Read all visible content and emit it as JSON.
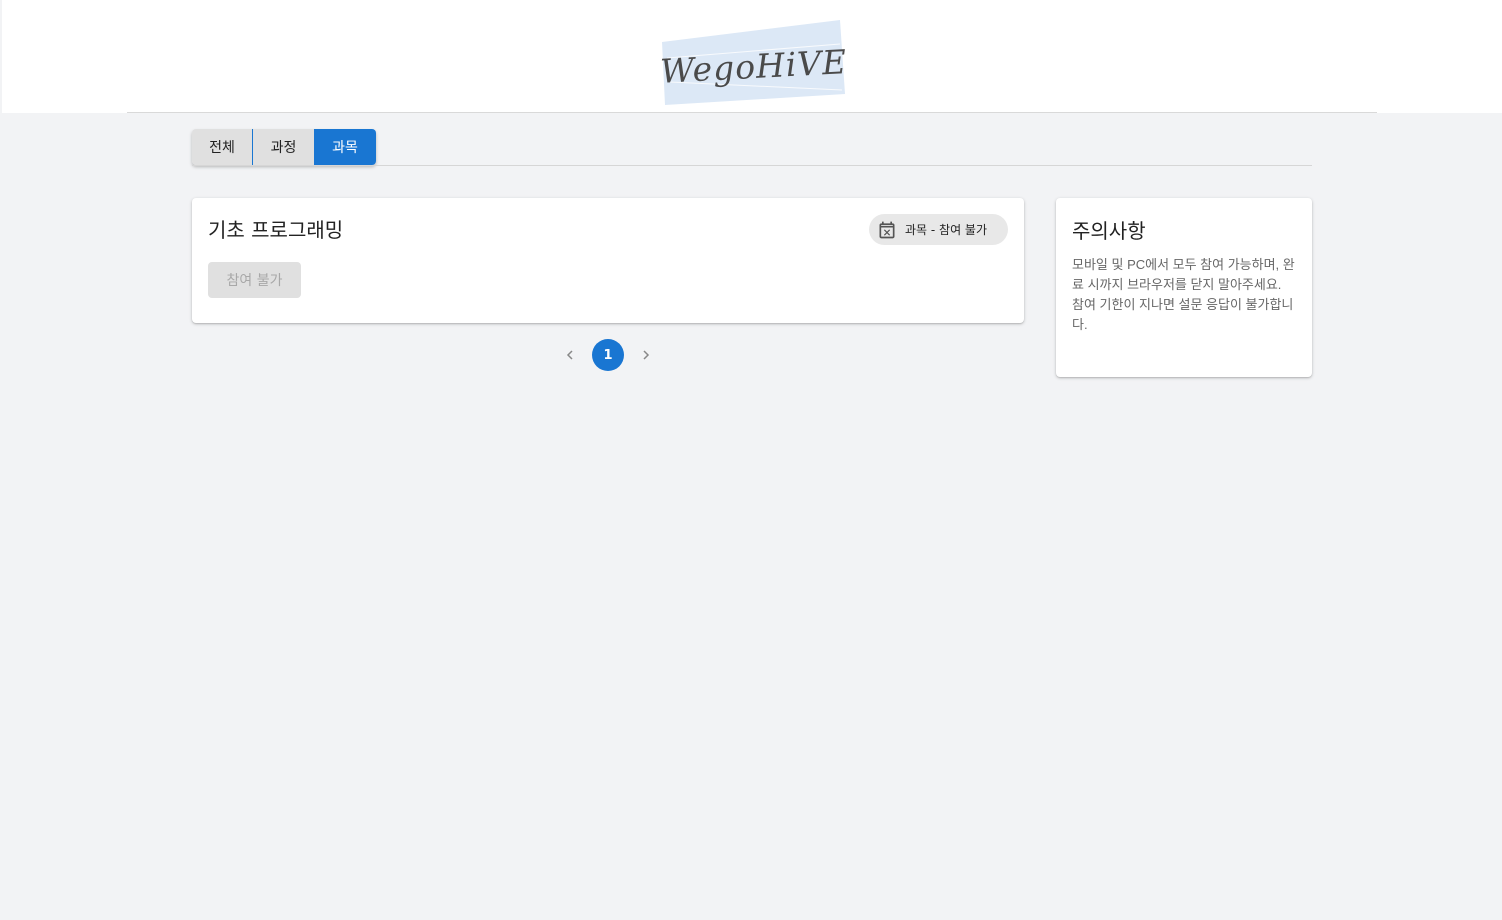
{
  "header": {
    "logo_text": "WegoHiVE",
    "logo_color": "#dce8f6"
  },
  "tabs": [
    {
      "label": "전체",
      "selected": false
    },
    {
      "label": "과정",
      "selected": false
    },
    {
      "label": "과목",
      "selected": true
    }
  ],
  "course": {
    "title": "기초 프로그래밍",
    "status_chip": "과목 - 참여 불가",
    "status_icon": "calendar-x-icon",
    "join_button": "참여 불가",
    "join_disabled": true
  },
  "pagination": {
    "prev_icon": "chevron-left-icon",
    "current_page": "1",
    "next_icon": "chevron-right-icon"
  },
  "notice": {
    "title": "주의사항",
    "line1": "모바일 및 PC에서 모두 참여 가능하며, 완료 시까지 브라우저를 닫지 말아주세요.",
    "line2": "참여 기한이 지나면 설문 응답이 불가합니다."
  },
  "colors": {
    "primary": "#1976d2",
    "background": "#f2f3f5"
  }
}
